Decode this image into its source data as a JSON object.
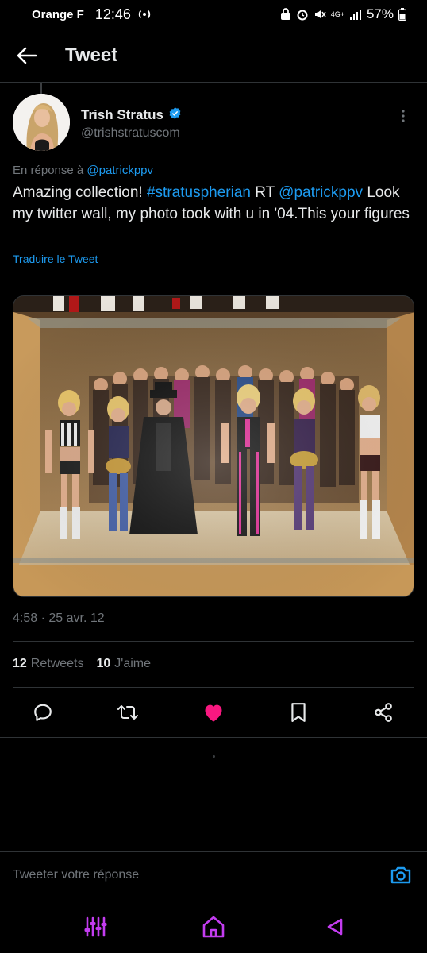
{
  "status_bar": {
    "carrier": "Orange F",
    "time": "12:46",
    "network": "4G+",
    "battery": "57%"
  },
  "header": {
    "title": "Tweet"
  },
  "author": {
    "name": "Trish Stratus",
    "handle": "@trishstratuscom",
    "verified": true
  },
  "reply_to": {
    "prefix": "En réponse à",
    "mention": "@patrickppv"
  },
  "tweet": {
    "text_1": "Amazing collection!",
    "hashtag": "#stratuspherian",
    "text_2": "RT",
    "mention": "@patrickppv",
    "text_3": "Look my twitter wall, my photo took with u in '04.This your figures",
    "translate_label": "Traduire le Tweet",
    "timestamp": "4:58 · 25 avr. 12"
  },
  "stats": {
    "retweets_count": "12",
    "retweets_label": "Retweets",
    "likes_count": "10",
    "likes_label": "J'aime"
  },
  "actions": {
    "reply_icon": "reply-icon",
    "retweet_icon": "retweet-icon",
    "like_icon": "heart-icon",
    "bookmark_icon": "bookmark-icon",
    "share_icon": "share-icon",
    "liked": true
  },
  "reply_bar": {
    "placeholder": "Tweeter votre réponse"
  },
  "colors": {
    "accent": "#1d9bf0",
    "like": "#f91880",
    "nav": "#c33cf0"
  }
}
